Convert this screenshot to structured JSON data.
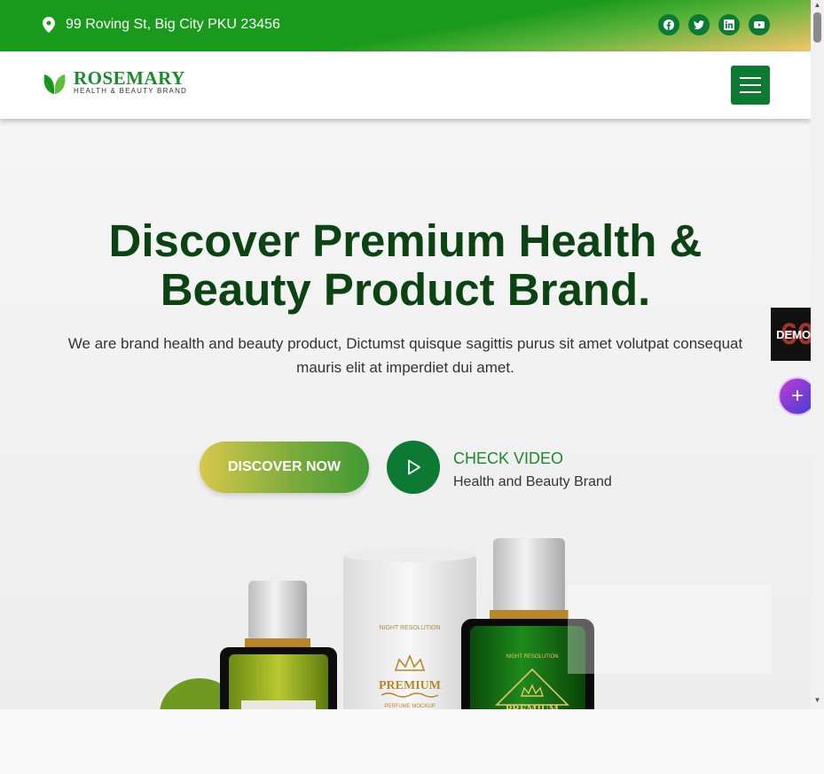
{
  "topbar": {
    "address": "99 Roving St, Big City PKU 23456",
    "socials": [
      {
        "icon": "facebook-icon"
      },
      {
        "icon": "twitter-icon"
      },
      {
        "icon": "linkedin-icon"
      },
      {
        "icon": "youtube-icon"
      }
    ]
  },
  "brand": {
    "name": "ROSEMARY",
    "tagline": "HEALTH & BEAUTY BRAND"
  },
  "hero": {
    "title_line1": "Discover Premium Health &",
    "title_line2": "Beauty Product Brand.",
    "subtitle": "We are brand health and beauty product, Dictumst quisque sagittis purus sit amet volutpat consequat mauris elit at imperdiet dui amet.",
    "cta_label": "DISCOVER NOW",
    "video_title": "CHECK VIDEO",
    "video_subtitle": "Health and Beauty Brand"
  },
  "products": {
    "box_small_text": "NIGHT RESOLUTION",
    "box_label": "PREMIUM",
    "box_fine_print": "PERFUME MOCKUP",
    "bottle_small_text": "NIGHT RESOLUTION",
    "bottle_label": "PREMIUM"
  },
  "widgets": {
    "demos_label": "DEMOS",
    "demos_count": "60",
    "plus_label": "+"
  },
  "colors": {
    "brand_green": "#0c7a32",
    "title_green": "#0b4312",
    "topbar_green": "#1a9a1c"
  }
}
